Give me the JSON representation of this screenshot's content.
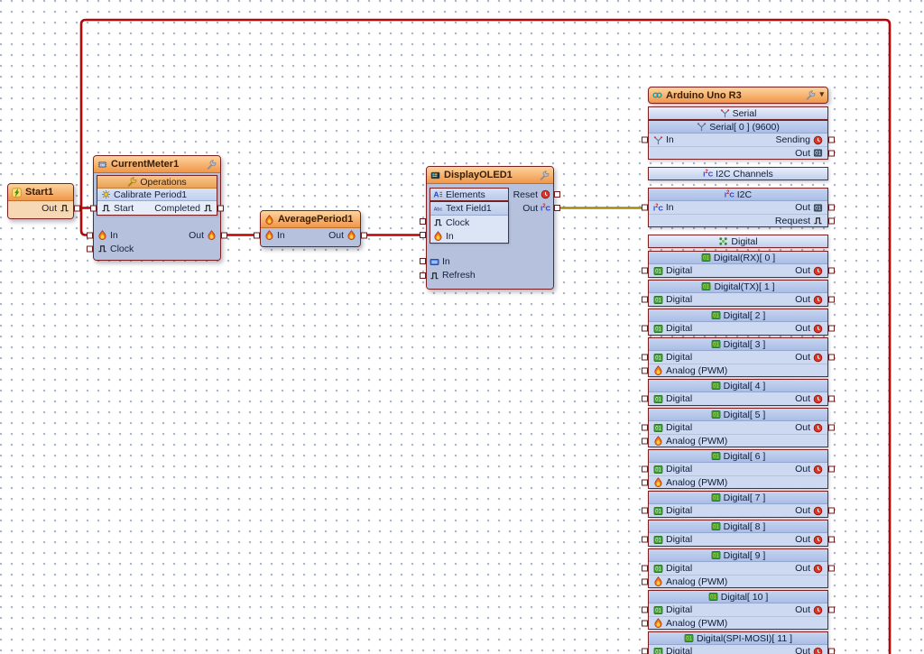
{
  "palette": {
    "wire_signal": "#b80505",
    "wire_i2c": "#a08a10",
    "header_orange_top": "#fdd49e",
    "header_orange_bottom": "#f0964a",
    "body_periwinkle": "#b6c1dd",
    "row_blue": "#cdd9f1",
    "border_maroon": "#7a2020"
  },
  "connections": [
    {
      "from": "Start1.Out",
      "to": "CurrentMeter1.Start",
      "color": "red"
    },
    {
      "from": "CurrentMeter1.Out",
      "to": "AveragePeriod1.In",
      "color": "red"
    },
    {
      "from": "AveragePeriod1.Out",
      "to": "DisplayOLED1.In",
      "color": "red"
    },
    {
      "from": "DisplayOLED1.Out",
      "to": "ArduinoUnoR3.I2C.In",
      "color": "olive"
    },
    {
      "from": "CurrentMeter1.In",
      "to": "off-screen-bottom-right",
      "color": "red",
      "note": "routes around top and right edge of canvas"
    }
  ],
  "blocks": {
    "start": {
      "title": "Start1",
      "out_label": "Out"
    },
    "current_meter": {
      "title": "CurrentMeter1",
      "operations_label": "Operations",
      "calibrate_label": "Calibrate Period1",
      "start_label": "Start",
      "completed_label": "Completed",
      "in_label": "In",
      "out_label": "Out",
      "clock_label": "Clock"
    },
    "average_period": {
      "title": "AveragePeriod1",
      "in_label": "In",
      "out_label": "Out"
    },
    "display_oled": {
      "title": "DisplayOLED1",
      "elements_label": "Elements",
      "text_field_label": "Text Field1",
      "clock_label": "Clock",
      "in_label": "In",
      "reset_label": "Reset",
      "out_label": "Out",
      "display_in_label": "In",
      "refresh_label": "Refresh"
    },
    "arduino": {
      "title": "Arduino Uno R3",
      "groups": [
        {
          "gap": 0,
          "banner": true,
          "rows": [
            {
              "type": "banner",
              "label": "Serial",
              "icon": "serial"
            }
          ]
        },
        {
          "gap": 0,
          "rows": [
            {
              "type": "channel",
              "label": "Serial[ 0 ] (9600)",
              "icon": "serial"
            },
            {
              "type": "pins",
              "left": {
                "label": "In",
                "icon": "serial"
              },
              "right": {
                "label": "Sending",
                "icon": "clockred"
              }
            },
            {
              "type": "pins",
              "right": {
                "label": "Out",
                "icon": "binary"
              }
            }
          ]
        },
        {
          "gap": 8,
          "banner": true,
          "rows": [
            {
              "type": "banner",
              "label": "I2C Channels",
              "icon": "i2c"
            }
          ]
        },
        {
          "gap": 8,
          "rows": [
            {
              "type": "channel",
              "label": "I2C",
              "icon": "i2c"
            },
            {
              "type": "pins",
              "left": {
                "label": "In",
                "icon": "i2c"
              },
              "right": {
                "label": "Out",
                "icon": "binary"
              }
            },
            {
              "type": "pins",
              "right": {
                "label": "Request",
                "icon": "pulse"
              }
            }
          ]
        },
        {
          "gap": 8,
          "banner": true,
          "rows": [
            {
              "type": "banner",
              "label": "Digital",
              "icon": "digitalbanner"
            }
          ]
        },
        {
          "gap": 3,
          "rows": [
            {
              "type": "channel",
              "label": "Digital(RX)[ 0 ]",
              "icon": "digitalpin"
            },
            {
              "type": "pins",
              "left": {
                "label": "Digital",
                "icon": "digitalgreen"
              },
              "right": {
                "label": "Out",
                "icon": "clockred"
              }
            }
          ]
        },
        {
          "gap": 2,
          "rows": [
            {
              "type": "channel",
              "label": "Digital(TX)[ 1 ]",
              "icon": "digitalpin"
            },
            {
              "type": "pins",
              "left": {
                "label": "Digital",
                "icon": "digitalgreen"
              },
              "right": {
                "label": "Out",
                "icon": "clockred"
              }
            }
          ]
        },
        {
          "gap": 2,
          "rows": [
            {
              "type": "channel",
              "label": "Digital[ 2 ]",
              "icon": "digitalpin"
            },
            {
              "type": "pins",
              "left": {
                "label": "Digital",
                "icon": "digitalgreen"
              },
              "right": {
                "label": "Out",
                "icon": "clockred"
              }
            }
          ]
        },
        {
          "gap": 2,
          "rows": [
            {
              "type": "channel",
              "label": "Digital[ 3 ]",
              "icon": "digitalpin"
            },
            {
              "type": "pins",
              "left": {
                "label": "Digital",
                "icon": "digitalgreen"
              },
              "right": {
                "label": "Out",
                "icon": "clockred"
              }
            },
            {
              "type": "pins",
              "left": {
                "label": "Analog (PWM)",
                "icon": "flame"
              }
            }
          ]
        },
        {
          "gap": 2,
          "rows": [
            {
              "type": "channel",
              "label": "Digital[ 4 ]",
              "icon": "digitalpin"
            },
            {
              "type": "pins",
              "left": {
                "label": "Digital",
                "icon": "digitalgreen"
              },
              "right": {
                "label": "Out",
                "icon": "clockred"
              }
            }
          ]
        },
        {
          "gap": 2,
          "rows": [
            {
              "type": "channel",
              "label": "Digital[ 5 ]",
              "icon": "digitalpin"
            },
            {
              "type": "pins",
              "left": {
                "label": "Digital",
                "icon": "digitalgreen"
              },
              "right": {
                "label": "Out",
                "icon": "clockred"
              }
            },
            {
              "type": "pins",
              "left": {
                "label": "Analog (PWM)",
                "icon": "flame"
              }
            }
          ]
        },
        {
          "gap": 2,
          "rows": [
            {
              "type": "channel",
              "label": "Digital[ 6 ]",
              "icon": "digitalpin"
            },
            {
              "type": "pins",
              "left": {
                "label": "Digital",
                "icon": "digitalgreen"
              },
              "right": {
                "label": "Out",
                "icon": "clockred"
              }
            },
            {
              "type": "pins",
              "left": {
                "label": "Analog (PWM)",
                "icon": "flame"
              }
            }
          ]
        },
        {
          "gap": 2,
          "rows": [
            {
              "type": "channel",
              "label": "Digital[ 7 ]",
              "icon": "digitalpin"
            },
            {
              "type": "pins",
              "left": {
                "label": "Digital",
                "icon": "digitalgreen"
              },
              "right": {
                "label": "Out",
                "icon": "clockred"
              }
            }
          ]
        },
        {
          "gap": 2,
          "rows": [
            {
              "type": "channel",
              "label": "Digital[ 8 ]",
              "icon": "digitalpin"
            },
            {
              "type": "pins",
              "left": {
                "label": "Digital",
                "icon": "digitalgreen"
              },
              "right": {
                "label": "Out",
                "icon": "clockred"
              }
            }
          ]
        },
        {
          "gap": 2,
          "rows": [
            {
              "type": "channel",
              "label": "Digital[ 9 ]",
              "icon": "digitalpin"
            },
            {
              "type": "pins",
              "left": {
                "label": "Digital",
                "icon": "digitalgreen"
              },
              "right": {
                "label": "Out",
                "icon": "clockred"
              }
            },
            {
              "type": "pins",
              "left": {
                "label": "Analog (PWM)",
                "icon": "flame"
              }
            }
          ]
        },
        {
          "gap": 2,
          "rows": [
            {
              "type": "channel",
              "label": "Digital[ 10 ]",
              "icon": "digitalpin"
            },
            {
              "type": "pins",
              "left": {
                "label": "Digital",
                "icon": "digitalgreen"
              },
              "right": {
                "label": "Out",
                "icon": "clockred"
              }
            },
            {
              "type": "pins",
              "left": {
                "label": "Analog (PWM)",
                "icon": "flame"
              }
            }
          ]
        },
        {
          "gap": 2,
          "rows": [
            {
              "type": "channel",
              "label": "Digital(SPI-MOSI)[ 11 ]",
              "icon": "digitalpin"
            },
            {
              "type": "pins",
              "left": {
                "label": "Digital",
                "icon": "digitalgreen"
              },
              "right": {
                "label": "Out",
                "icon": "clockred"
              }
            }
          ]
        }
      ]
    }
  }
}
